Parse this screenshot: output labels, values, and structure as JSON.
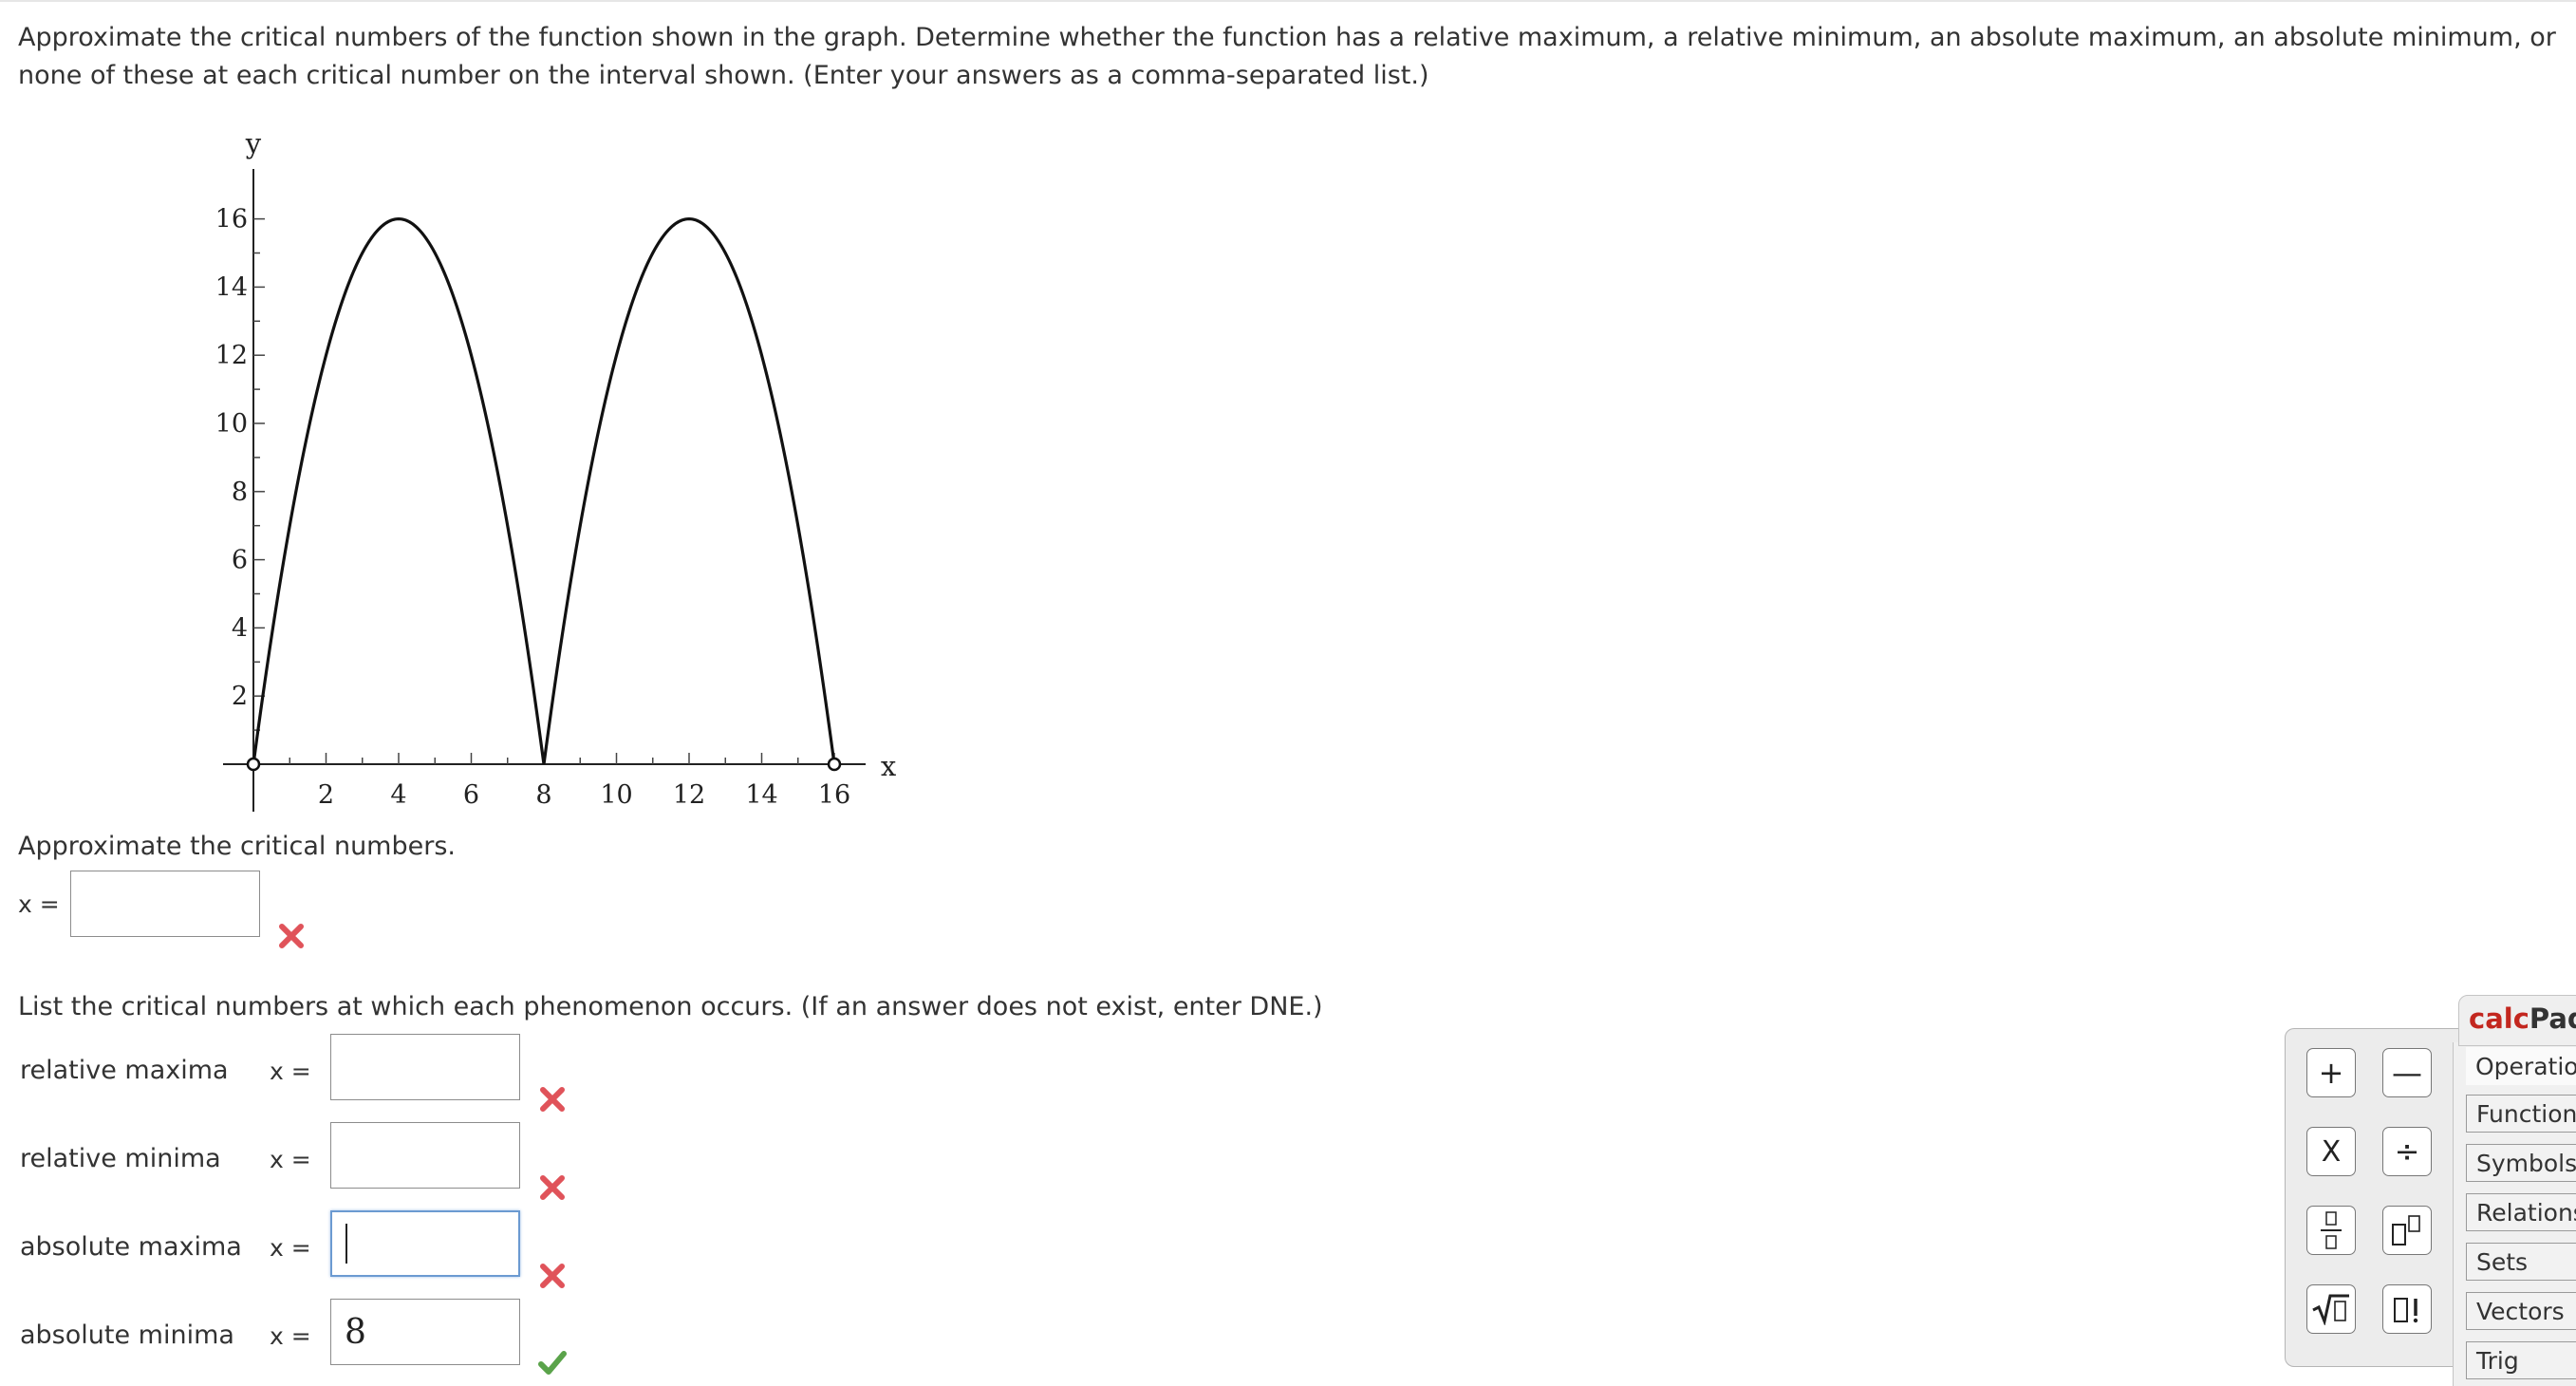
{
  "question": {
    "text": "Approximate the critical numbers of the function shown in the graph. Determine whether the function has a relative maximum, a relative minimum, an absolute maximum, an absolute minimum, or none of these at each critical number on the interval shown. (Enter your answers as a comma-separated list.)"
  },
  "chart_data": {
    "type": "line",
    "xlabel": "x",
    "ylabel": "y",
    "xlim": [
      0,
      16
    ],
    "ylim": [
      0,
      16
    ],
    "x_ticks": [
      2,
      4,
      6,
      8,
      10,
      12,
      14,
      16
    ],
    "y_ticks": [
      2,
      4,
      6,
      8,
      10,
      12,
      14,
      16
    ],
    "x_tick_labels": [
      "2",
      "4",
      "6",
      "8",
      "10",
      "12",
      "14",
      "16"
    ],
    "y_tick_labels": [
      "2",
      "4",
      "6",
      "8",
      "10",
      "12",
      "14",
      "16"
    ],
    "series": [
      {
        "x": [
          0,
          1,
          2,
          3,
          4,
          5,
          6,
          7,
          8,
          9,
          10,
          11,
          12,
          13,
          14,
          15,
          16
        ],
        "y": [
          0,
          7,
          12,
          15,
          16,
          15,
          12,
          7,
          0,
          7,
          12,
          15,
          16,
          15,
          12,
          7,
          0
        ]
      }
    ],
    "open_endpoints": [
      [
        0,
        0
      ],
      [
        16,
        0
      ]
    ],
    "grid": false
  },
  "critical": {
    "prompt": "Approximate the critical numbers.",
    "x_label": "x =",
    "value": "",
    "status": "incorrect"
  },
  "phenomena": {
    "prompt": "List the critical numbers at which each phenomenon occurs. (If an answer does not exist, enter DNE.)",
    "x_label": "x =",
    "rows": [
      {
        "label": "relative maxima",
        "value": "",
        "status": "incorrect"
      },
      {
        "label": "relative minima",
        "value": "",
        "status": "incorrect"
      },
      {
        "label": "absolute maxima",
        "value": "",
        "status": "incorrect"
      },
      {
        "label": "absolute minima",
        "value": "8",
        "status": "correct"
      }
    ]
  },
  "calcpad": {
    "title_red": "calc",
    "title_rest": "Pad",
    "tabs": [
      "Operations",
      "Functions",
      "Symbols",
      "Relations",
      "Sets",
      "Vectors",
      "Trig"
    ],
    "buttons": [
      {
        "name": "plus-button",
        "glyph": "+"
      },
      {
        "name": "minus-button",
        "glyph": "—"
      },
      {
        "name": "times-button",
        "glyph": "X"
      },
      {
        "name": "divide-button",
        "glyph": "÷"
      },
      {
        "name": "fraction-button",
        "glyph": "fraction"
      },
      {
        "name": "power-button",
        "glyph": "power"
      },
      {
        "name": "sqrt-button",
        "glyph": "sqrt"
      },
      {
        "name": "factorial-button",
        "glyph": "▯!"
      }
    ]
  },
  "colors": {
    "incorrect": "#e0535a",
    "correct": "#5aa34a",
    "calc_red": "#c3271f"
  }
}
